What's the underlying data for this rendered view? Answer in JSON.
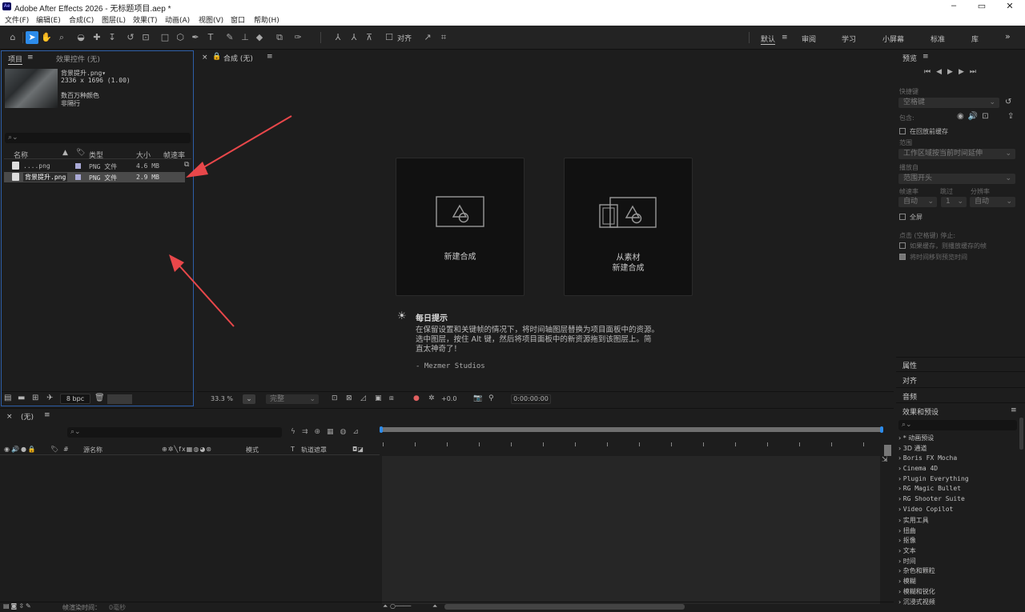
{
  "window": {
    "logo": "Ae",
    "title": "Adobe After Effects 2026 - 无标题项目.aep *",
    "controls": [
      "minimize-icon",
      "maximize-icon",
      "close-icon"
    ]
  },
  "menu": [
    "文件(F)",
    "编辑(E)",
    "合成(C)",
    "图层(L)",
    "效果(T)",
    "动画(A)",
    "视图(V)",
    "窗口",
    "帮助(H)"
  ],
  "toolbar": {
    "align_label": "对齐"
  },
  "workspaces": [
    "默认",
    "审阅",
    "学习",
    "小屏幕",
    "标准",
    "库"
  ],
  "project": {
    "tab": "项目",
    "effects_tab": "效果控件 (无)",
    "selected_name": "背景提升.png▾",
    "selected_dims": "2336 x 1696 (1.00)",
    "selected_colors": "数百万种颜色",
    "selected_interlace": "非隔行",
    "columns": [
      "名称",
      "类型",
      "大小",
      "帧速率"
    ],
    "rows": [
      {
        "name": "....png",
        "type": "PNG 文件",
        "size": "4.6 MB"
      },
      {
        "name": "背景提升.png",
        "type": "PNG 文件",
        "size": "2.9 MB"
      }
    ],
    "bpc": "8 bpc"
  },
  "composition": {
    "tab": "合成 (无)",
    "new_comp": "新建合成",
    "from_footage_1": "从素材",
    "from_footage_2": "新建合成",
    "tip_title": "每日提示",
    "tip_line1": "在保留设置和关键帧的情况下，将时间轴图层替换为项目面板中的资源。",
    "tip_line2": "选中图层，按住 Alt 键，然后将项目面板中的新资源拖到该图层上。简",
    "tip_line3": "直太神奇了！",
    "tip_author": "- Mezmer Studios",
    "zoom": "33.3 %",
    "quality": "完整",
    "exposure": "+0.0",
    "timecode": "0:00:00:00"
  },
  "timeline": {
    "tab": "(无)",
    "cols": {
      "source": "源名称",
      "mode": "模式",
      "t": "T",
      "track": "轨道遮罩",
      "hash": "#"
    },
    "render_label": "帧渲染时间：",
    "render_value": "0毫秒"
  },
  "preview": {
    "title": "预览",
    "shortcut_label": "快捷键",
    "shortcut_value": "空格键",
    "include_label": "包含:",
    "cache_before": "在回放前缓存",
    "range_label": "范围",
    "range_value": "工作区域按当前时间延伸",
    "play_from_label": "播放自",
    "play_from_value": "范围开头",
    "fps_label": "帧速率",
    "skip_label": "跳过",
    "res_label": "分辨率",
    "fps_value": "自动",
    "skip_value": "1",
    "res_value": "自动",
    "fullscreen": "全屏",
    "stop_label": "点击 (空格键) 停止:",
    "if_cached": "如果缓存，则播放缓存的帧",
    "move_time": "将时间移到预览时间"
  },
  "side_panels": [
    "属性",
    "对齐",
    "音频"
  ],
  "effects": {
    "title": "效果和预设",
    "items": [
      "* 动画预设",
      "3D 通道",
      "Boris FX Mocha",
      "Cinema 4D",
      "Plugin Everything",
      "RG Magic Bullet",
      "RG Shooter Suite",
      "Video Copilot",
      "实用工具",
      "扭曲",
      "抠像",
      "文本",
      "时间",
      "杂色和颗粒",
      "模糊",
      "模糊和锐化",
      "沉浸式视频"
    ]
  },
  "colors": {
    "accent": "#2d8ceb",
    "annotation": "#e8474a",
    "selected_row": "#4a4a4a",
    "label_purple": "#a9a9d6"
  }
}
